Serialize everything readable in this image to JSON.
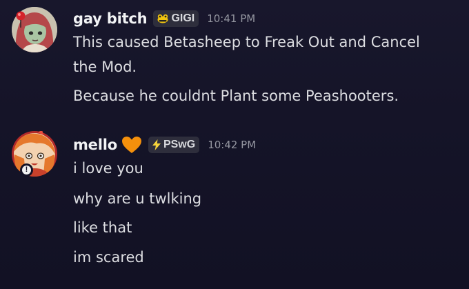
{
  "messages": [
    {
      "username": "gay bitch",
      "tag": "GIGI",
      "tag_icon": "frog-icon",
      "timestamp": "10:41 PM",
      "lines": [
        "This caused Betasheep to Freak Out and Cancel",
        "the Mod.",
        "Because he couldnt Plant some Peashooters."
      ]
    },
    {
      "username": "mello",
      "username_emoji": "orange-heart-icon",
      "tag": "PSwG",
      "tag_icon": "lightning-icon",
      "timestamp": "10:42 PM",
      "lines": [
        "i love you",
        "why are u twlking",
        "like that",
        "im scared"
      ],
      "status_badge": "!"
    }
  ],
  "colors": {
    "background": "#151428",
    "username": "#f2f3f5",
    "message_text": "#dcdde1",
    "timestamp": "#9496a0",
    "tag_background": "#2e2e3c",
    "tag_lightning": "#f5d33b",
    "heart": "#f4900c"
  }
}
